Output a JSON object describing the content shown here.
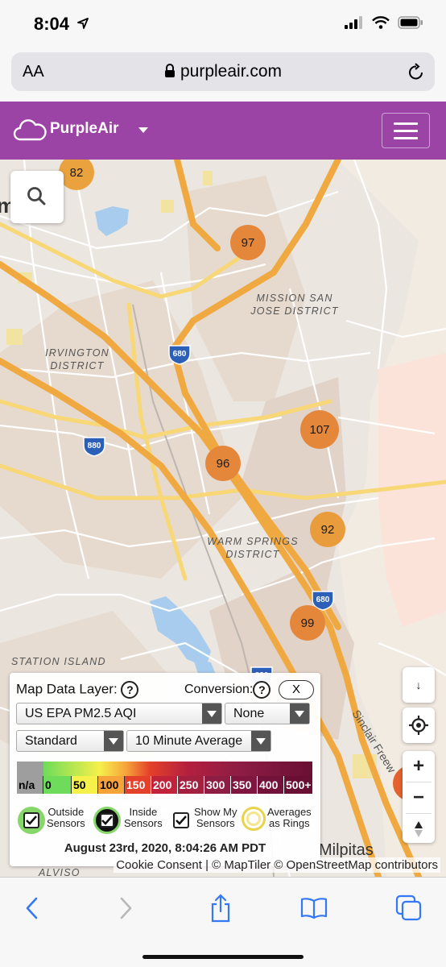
{
  "status": {
    "time": "8:04"
  },
  "browser": {
    "aa_label": "AA",
    "url": "purpleair.com"
  },
  "header": {
    "brand": "PurpleAir"
  },
  "map": {
    "labels": [
      {
        "id": "mission",
        "text1": "MISSION SAN",
        "text2": "JOSE DISTRICT"
      },
      {
        "id": "irvington",
        "text1": "IRVINGTON",
        "text2": "DISTRICT"
      },
      {
        "id": "warm",
        "text1": "WARM SPRINGS",
        "text2": "DISTRICT"
      },
      {
        "id": "station",
        "text1": "STATION ISLAND"
      },
      {
        "id": "alviso",
        "text1": "ALVISO"
      },
      {
        "id": "milpitas",
        "text1": "Milpitas"
      },
      {
        "id": "sinclair",
        "text1": "Sinclair Freew"
      },
      {
        "id": "partial_m",
        "text1": "m"
      }
    ],
    "shields": [
      "680",
      "880",
      "680",
      "880"
    ],
    "markers": [
      {
        "id": "m82",
        "value": "82"
      },
      {
        "id": "m97",
        "value": "97"
      },
      {
        "id": "m107",
        "value": "107"
      },
      {
        "id": "m96",
        "value": "96"
      },
      {
        "id": "m92",
        "value": "92"
      },
      {
        "id": "m99",
        "value": "99"
      }
    ]
  },
  "controls": {
    "compass_label": "↓",
    "zoom_in": "+",
    "zoom_out": "−"
  },
  "panel": {
    "layer_label": "Map Data Layer:",
    "help": "?",
    "conversion_label": "Conversion:",
    "close_label": "X",
    "layer_value": "US EPA PM2.5 AQI",
    "conversion_value": "None",
    "style_value": "Standard",
    "average_value": "10 Minute Average",
    "legend": [
      "n/a",
      "0",
      "50",
      "100",
      "150",
      "200",
      "250",
      "300",
      "350",
      "400",
      "500+"
    ],
    "legend_colors": [
      "#9e9e9e",
      "#6edc5a",
      "#f6f04b",
      "#f6a33a",
      "#e4412a",
      "#c1243a",
      "#a3203f",
      "#8e1d44",
      "#80153f",
      "#72123a",
      "#6a0f34"
    ],
    "checkboxes": [
      {
        "line1": "Outside",
        "line2": "Sensors"
      },
      {
        "line1": "Inside",
        "line2": "Sensors"
      },
      {
        "line1": "Show My",
        "line2": "Sensors"
      },
      {
        "line1": "Averages",
        "line2": "as Rings"
      }
    ],
    "datetime": "August 23rd, 2020, 8:04:26 AM PDT"
  },
  "attribution": "Cookie Consent | © MapTiler © OpenStreetMap contributors",
  "colors": {
    "brand": "#9b44a6",
    "marker": "#e4873a",
    "ios_blue": "#3478f6"
  }
}
